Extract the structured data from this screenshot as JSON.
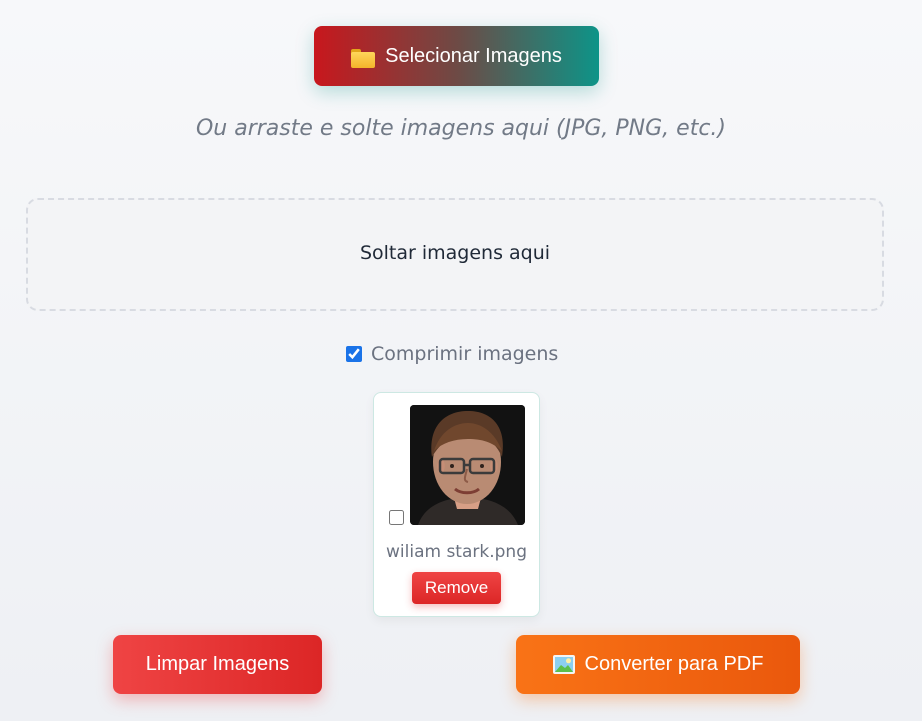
{
  "actions": {
    "select_label": "Selecionar Imagens",
    "select_icon": "folder-icon",
    "clear_label": "Limpar Imagens",
    "convert_label": "Converter para PDF",
    "convert_icon": "picture-icon"
  },
  "hint": "Ou arraste e solte imagens aqui (JPG, PNG, etc.)",
  "dropzone": {
    "label": "Soltar imagens aqui"
  },
  "compress": {
    "label": "Comprimir imagens",
    "checked": true
  },
  "images": [
    {
      "filename": "wiliam stark.png",
      "selected": false,
      "remove_label": "Remove"
    }
  ],
  "colors": {
    "select_gradient": [
      "#c8171d",
      "#0d9488"
    ],
    "clear": "#ef4444",
    "convert": "#f97316",
    "remove": "#dc2626",
    "checkbox": "#1a73e8"
  }
}
